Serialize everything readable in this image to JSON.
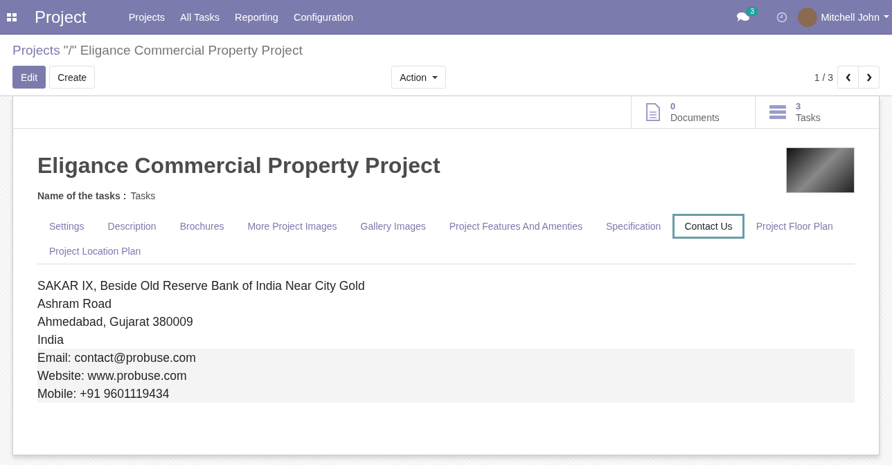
{
  "navbar": {
    "app_name": "Project",
    "menu": [
      "Projects",
      "All Tasks",
      "Reporting",
      "Configuration"
    ],
    "messages_count": "3",
    "user": "Mitchell John"
  },
  "breadcrumb": {
    "parent": "Projects",
    "current": "\"/\" Eligance Commercial Property Project"
  },
  "buttons": {
    "edit": "Edit",
    "create": "Create",
    "action": "Action"
  },
  "pager": "1 / 3",
  "stat_buttons": [
    {
      "kind": "documents",
      "value": "0",
      "label": "Documents"
    },
    {
      "kind": "tasks",
      "value": "3",
      "label": "Tasks"
    }
  ],
  "title": "Eligance Commercial Property Project",
  "field": {
    "label": "Name of the tasks :",
    "value": "Tasks"
  },
  "tabs": [
    {
      "label": "Settings",
      "selected": false
    },
    {
      "label": "Description",
      "selected": false
    },
    {
      "label": "Brochures",
      "selected": false
    },
    {
      "label": "More Project Images",
      "selected": false
    },
    {
      "label": "Gallery Images",
      "selected": false
    },
    {
      "label": "Project Features And Amenties",
      "selected": false
    },
    {
      "label": "Specification",
      "selected": false
    },
    {
      "label": "Contact Us",
      "selected": true
    },
    {
      "label": "Project Floor Plan",
      "selected": false
    },
    {
      "label": "Project Location Plan",
      "selected": false
    }
  ],
  "address_lines": [
    "SAKAR IX, Beside Old Reserve Bank of India Near City Gold",
    "Ashram Road",
    "Ahmedabad, Gujarat 380009",
    "India"
  ],
  "contact_details": [
    "Email: contact@probuse.com",
    "Website: www.probuse.com",
    "Mobile: +91 9601119434"
  ]
}
